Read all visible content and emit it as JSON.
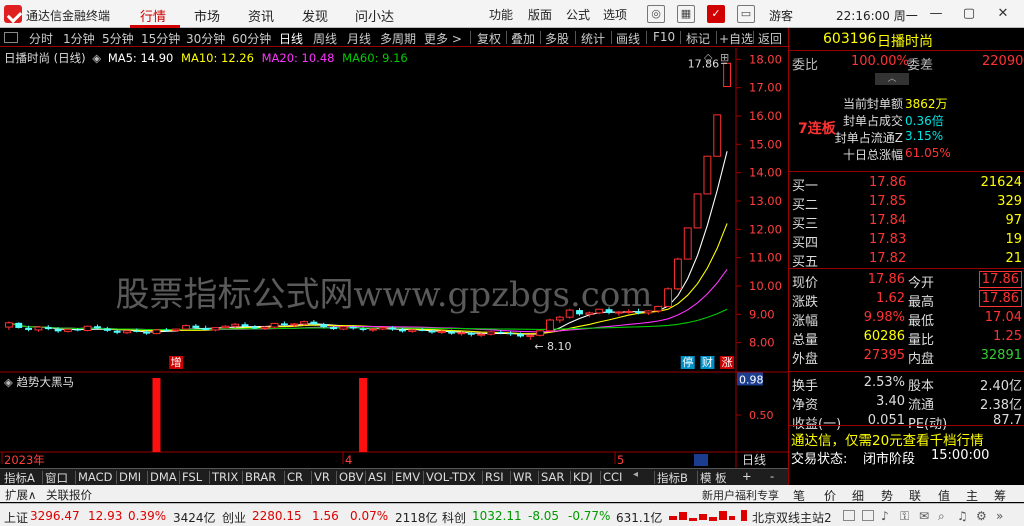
{
  "app": {
    "name": "通达信金融终端"
  },
  "menu": {
    "main": [
      "行情",
      "市场",
      "资讯",
      "发现",
      "问小达"
    ],
    "active": "行情",
    "secondary": [
      "功能",
      "版面",
      "公式",
      "选项"
    ],
    "guest": "游客",
    "clock": "22:16:00 周一"
  },
  "toolbar": {
    "periods": [
      "分时",
      "1分钟",
      "5分钟",
      "15分钟",
      "30分钟",
      "60分钟",
      "日线",
      "周线",
      "月线",
      "多周期",
      "更多 >"
    ],
    "active_period": "日线",
    "actions": [
      "复权",
      "叠加",
      "多股",
      "统计",
      "画线",
      "F10",
      "标记",
      "+自选",
      "返回"
    ]
  },
  "chart_data": [
    {
      "type": "candlestick",
      "title": "日播时尚 (日线)",
      "ma_legend": {
        "ma5": {
          "label": "MA5:",
          "value": "14.90",
          "color": "#ffffff"
        },
        "ma10": {
          "label": "MA10:",
          "value": "12.26",
          "color": "#ffff00"
        },
        "ma20": {
          "label": "MA20:",
          "value": "10.48",
          "color": "#ff33ff"
        },
        "ma60": {
          "label": "MA60:",
          "value": "9.16",
          "color": "#00cc00"
        }
      },
      "ylim": [
        7.6,
        18.4
      ],
      "y_ticks": [
        "18.00",
        "17.00",
        "16.00",
        "15.00",
        "14.00",
        "13.00",
        "12.00",
        "11.00",
        "10.00",
        "9.00",
        "8.00"
      ],
      "y_tick_values": [
        18,
        17,
        16,
        15,
        14,
        13,
        12,
        11,
        10,
        9,
        8
      ],
      "annotations": {
        "high": "17.86",
        "low": "8.10"
      },
      "markers": [
        "增",
        "停",
        "财",
        "涨"
      ],
      "x_labels": [
        "2023年",
        "4",
        "5"
      ],
      "candles": [
        [
          8.55,
          8.75,
          8.45,
          8.7
        ],
        [
          8.7,
          8.72,
          8.5,
          8.52
        ],
        [
          8.52,
          8.6,
          8.4,
          8.45
        ],
        [
          8.45,
          8.58,
          8.38,
          8.55
        ],
        [
          8.55,
          8.62,
          8.44,
          8.48
        ],
        [
          8.48,
          8.55,
          8.35,
          8.4
        ],
        [
          8.4,
          8.5,
          8.36,
          8.47
        ],
        [
          8.47,
          8.52,
          8.4,
          8.43
        ],
        [
          8.43,
          8.6,
          8.4,
          8.58
        ],
        [
          8.58,
          8.64,
          8.45,
          8.5
        ],
        [
          8.5,
          8.56,
          8.38,
          8.42
        ],
        [
          8.42,
          8.48,
          8.3,
          8.35
        ],
        [
          8.35,
          8.45,
          8.3,
          8.42
        ],
        [
          8.42,
          8.5,
          8.36,
          8.38
        ],
        [
          8.38,
          8.44,
          8.28,
          8.32
        ],
        [
          8.32,
          8.48,
          8.3,
          8.45
        ],
        [
          8.45,
          8.52,
          8.4,
          8.43
        ],
        [
          8.43,
          8.5,
          8.38,
          8.48
        ],
        [
          8.48,
          8.65,
          8.45,
          8.6
        ],
        [
          8.6,
          8.66,
          8.5,
          8.52
        ],
        [
          8.52,
          8.6,
          8.42,
          8.45
        ],
        [
          8.45,
          8.55,
          8.4,
          8.53
        ],
        [
          8.53,
          8.62,
          8.48,
          8.58
        ],
        [
          8.58,
          8.7,
          8.52,
          8.65
        ],
        [
          8.65,
          8.72,
          8.55,
          8.57
        ],
        [
          8.57,
          8.62,
          8.48,
          8.5
        ],
        [
          8.5,
          8.58,
          8.45,
          8.55
        ],
        [
          8.55,
          8.7,
          8.5,
          8.68
        ],
        [
          8.68,
          8.75,
          8.6,
          8.62
        ],
        [
          8.62,
          8.7,
          8.55,
          8.66
        ],
        [
          8.66,
          8.78,
          8.6,
          8.74
        ],
        [
          8.74,
          8.8,
          8.62,
          8.65
        ],
        [
          8.65,
          8.7,
          8.5,
          8.55
        ],
        [
          8.55,
          8.62,
          8.45,
          8.48
        ],
        [
          8.48,
          8.58,
          8.44,
          8.56
        ],
        [
          8.56,
          8.62,
          8.46,
          8.5
        ],
        [
          8.5,
          8.55,
          8.4,
          8.45
        ],
        [
          8.45,
          8.52,
          8.38,
          8.48
        ],
        [
          8.48,
          8.56,
          8.44,
          8.53
        ],
        [
          8.53,
          8.58,
          8.42,
          8.46
        ],
        [
          8.46,
          8.52,
          8.36,
          8.4
        ],
        [
          8.4,
          8.48,
          8.35,
          8.45
        ],
        [
          8.45,
          8.52,
          8.4,
          8.42
        ],
        [
          8.42,
          8.48,
          8.32,
          8.36
        ],
        [
          8.36,
          8.44,
          8.3,
          8.4
        ],
        [
          8.4,
          8.46,
          8.28,
          8.32
        ],
        [
          8.32,
          8.4,
          8.25,
          8.35
        ],
        [
          8.35,
          8.4,
          8.22,
          8.28
        ],
        [
          8.28,
          8.36,
          8.2,
          8.3
        ],
        [
          8.3,
          8.42,
          8.25,
          8.38
        ],
        [
          8.38,
          8.44,
          8.3,
          8.34
        ],
        [
          8.34,
          8.4,
          8.24,
          8.3
        ],
        [
          8.3,
          8.36,
          8.18,
          8.22
        ],
        [
          8.22,
          8.3,
          8.1,
          8.26
        ],
        [
          8.26,
          8.45,
          8.22,
          8.42
        ],
        [
          8.42,
          8.85,
          8.4,
          8.8
        ],
        [
          8.8,
          8.95,
          8.7,
          8.9
        ],
        [
          8.9,
          9.2,
          8.85,
          9.15
        ],
        [
          9.15,
          9.22,
          8.95,
          9.0
        ],
        [
          9.0,
          9.1,
          8.9,
          9.05
        ],
        [
          9.05,
          9.2,
          9.0,
          9.18
        ],
        [
          9.18,
          9.25,
          9.0,
          9.05
        ],
        [
          9.05,
          9.12,
          8.95,
          9.08
        ],
        [
          9.08,
          9.18,
          9.02,
          9.1
        ],
        [
          9.1,
          9.2,
          9.0,
          9.05
        ],
        [
          9.05,
          9.15,
          8.98,
          9.12
        ],
        [
          9.12,
          9.3,
          9.05,
          9.28
        ],
        [
          9.28,
          9.95,
          9.25,
          9.9
        ],
        [
          9.9,
          11.0,
          9.85,
          10.95
        ],
        [
          10.95,
          12.05,
          10.95,
          12.05
        ],
        [
          12.05,
          13.25,
          12.05,
          13.25
        ],
        [
          13.25,
          14.58,
          13.25,
          14.58
        ],
        [
          14.58,
          16.04,
          14.58,
          16.04
        ],
        [
          17.04,
          17.86,
          17.04,
          17.86
        ]
      ]
    },
    {
      "type": "bar",
      "title": "趋势大黑马",
      "ylim": [
        0,
        1.0
      ],
      "y_ticks": [
        "0.98",
        "0.50"
      ],
      "y_tick_values": [
        0.98,
        0.5
      ],
      "signal_indices": [
        15,
        36
      ]
    }
  ],
  "quote": {
    "code": "603196",
    "name": "日播时尚",
    "webi_label": "委比",
    "webi_value": "100.00%",
    "wecha_label": "委差",
    "wecha_value": "22090",
    "limit_up_badge": "7连板",
    "stats": [
      {
        "label": "当前封单额",
        "value": "3862万",
        "color": "#ffff00"
      },
      {
        "label": "封单占成交",
        "value": "0.36倍",
        "color": "#00e5e5"
      },
      {
        "label": "封单占流通Z",
        "value": "3.15%",
        "color": "#00e5e5"
      },
      {
        "label": "十日总涨幅",
        "value": "61.05%",
        "color": "#ff3333"
      }
    ],
    "orderbook": [
      {
        "label": "买一",
        "price": "17.86",
        "vol": "21624"
      },
      {
        "label": "买二",
        "price": "17.85",
        "vol": "329"
      },
      {
        "label": "买三",
        "price": "17.84",
        "vol": "97"
      },
      {
        "label": "买四",
        "price": "17.83",
        "vol": "19"
      },
      {
        "label": "买五",
        "price": "17.82",
        "vol": "21"
      }
    ],
    "info": [
      {
        "l1": "现价",
        "v1": "17.86",
        "c1": "red",
        "l2": "今开",
        "v2": "17.86",
        "c2": "red",
        "boxed": true
      },
      {
        "l1": "涨跌",
        "v1": "1.62",
        "c1": "red",
        "l2": "最高",
        "v2": "17.86",
        "c2": "red",
        "boxed": true
      },
      {
        "l1": "涨幅",
        "v1": "9.98%",
        "c1": "red",
        "l2": "最低",
        "v2": "17.04",
        "c2": "red"
      },
      {
        "l1": "总量",
        "v1": "60286",
        "c1": "yellow",
        "l2": "量比",
        "v2": "1.25",
        "c2": "red"
      },
      {
        "l1": "外盘",
        "v1": "27395",
        "c1": "red",
        "l2": "内盘",
        "v2": "32891",
        "c2": "green"
      }
    ],
    "info2": [
      {
        "l1": "换手",
        "v1": "2.53%",
        "l2": "股本",
        "v2": "2.40亿"
      },
      {
        "l1": "净资",
        "v1": "3.40",
        "l2": "流通",
        "v2": "2.38亿"
      },
      {
        "l1": "收益(一)",
        "v1": "0.051",
        "l2": "PE(动)",
        "v2": "87.7"
      }
    ],
    "promo": "通达信，仅需20元查看千档行情",
    "trade_status_label": "交易状态:",
    "trade_status": "闭市阶段",
    "trade_time": "15:00:00"
  },
  "watermark": "股票指标公式网www.gpzbgs.com",
  "bottom_tabs": [
    "指标A",
    "窗口",
    "MACD",
    "DMI",
    "DMA",
    "FSL",
    "TRIX",
    "BRAR",
    "CR",
    "VR",
    "OBV",
    "ASI",
    "EMV",
    "VOL-TDX",
    "RSI",
    "WR",
    "SAR",
    "KDJ",
    "CCI",
    "指标B",
    "模 板"
  ],
  "bottom_tabs2": [
    "扩展∧",
    "关联报价"
  ],
  "side_btns": {
    "plus": "+",
    "minus": "-",
    "day": "日线"
  },
  "right_tabs": [
    "新用户福利专享",
    "笔",
    "价",
    "细",
    "势",
    "联",
    "值",
    "主",
    "筹"
  ],
  "status": {
    "sh_label": "上证",
    "sh_val": "3296.47",
    "sh_chg": "12.93",
    "sh_pct": "0.39%",
    "sh_amt": "3424亿",
    "cy_label": "创业",
    "cy_val": "2280.15",
    "cy_chg": "1.56",
    "cy_pct": "0.07%",
    "cy_amt": "2118亿",
    "kc_label": "科创",
    "kc_val": "1032.11",
    "kc_chg": "-8.05",
    "kc_pct": "-0.77%",
    "kc_amt": "631.1亿",
    "server": "北京双线主站2"
  }
}
